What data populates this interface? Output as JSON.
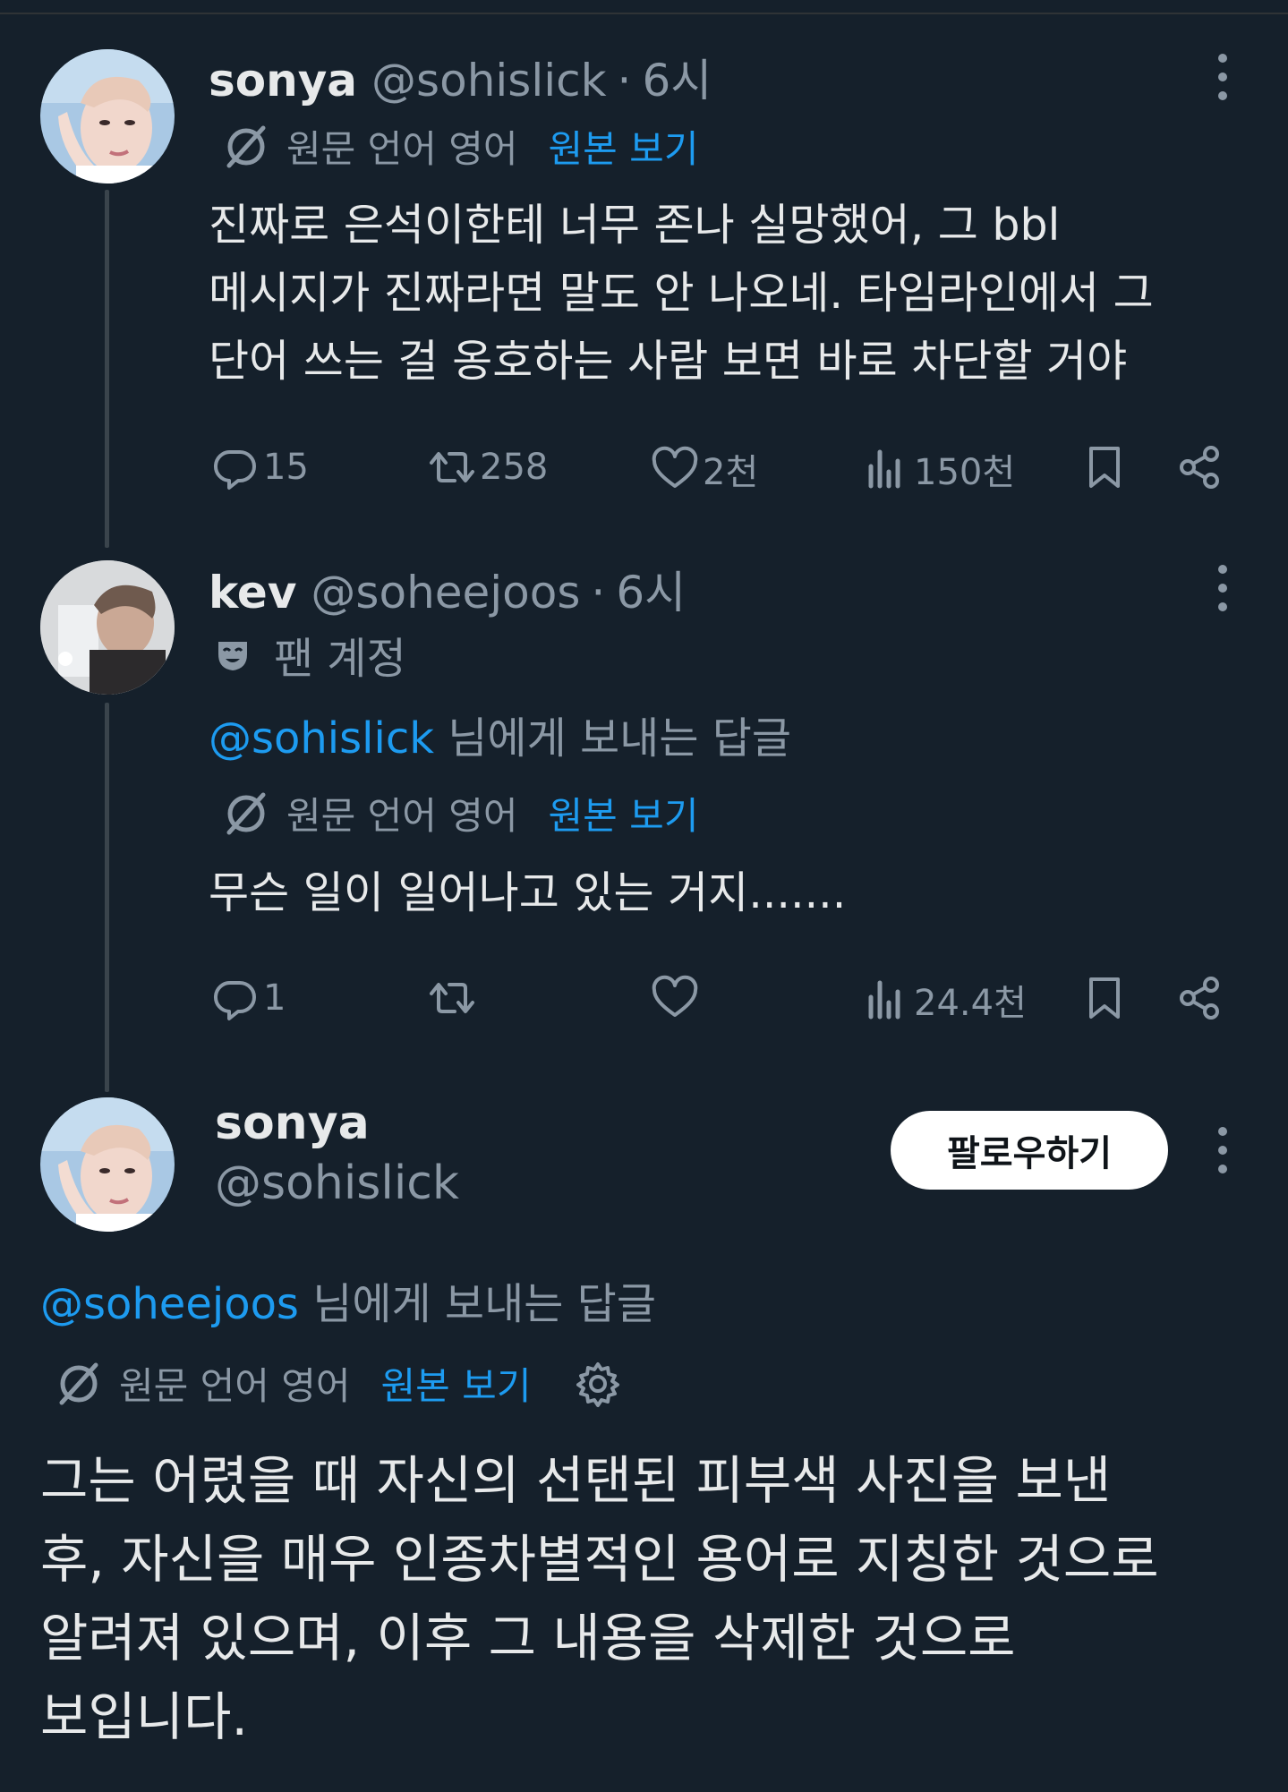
{
  "tweets": [
    {
      "name": "sonya",
      "handle": "@sohislick",
      "separator": "·",
      "time": "6시",
      "translation": {
        "label": "원문 언어 영어",
        "link": "원본 보기"
      },
      "text": "진짜로 은석이한테 너무 존나 실망했어, 그 bbl\n메시지가 진짜라면 말도 안 나오네. 타임라인에서 그\n단어 쓰는 걸 옹호하는 사람 보면 바로 차단할 거야",
      "stats": {
        "replies": "15",
        "retweets": "258",
        "likes": "2천",
        "views": "150천"
      }
    },
    {
      "name": "kev",
      "handle": "@soheejoos",
      "separator": "·",
      "time": "6시",
      "fan_label": "팬 계정",
      "reply_mention": "@sohislick",
      "reply_suffix": " 님에게 보내는 답글",
      "translation": {
        "label": "원문 언어 영어",
        "link": "원본 보기"
      },
      "text": "무슨 일이 일어나고 있는 거지.......",
      "stats": {
        "replies": "1",
        "retweets": "",
        "likes": "",
        "views": "24.4천"
      }
    },
    {
      "name": "sonya",
      "handle": "@sohislick",
      "follow_label": "팔로우하기",
      "reply_mention": "@soheejoos",
      "reply_suffix": " 님에게 보내는 답글",
      "translation": {
        "label": "원문 언어 영어",
        "link": "원본 보기"
      },
      "text": "그는 어렸을 때 자신의 선탠된 피부색 사진을 보낸\n후, 자신을 매우 인종차별적인 용어로 지칭한 것으로\n알려져 있으며, 이후 그 내용을 삭제한 것으로\n보입니다."
    }
  ],
  "colors": {
    "background": "#15202b",
    "text": "#e7e9ea",
    "muted": "#8b98a5",
    "accent": "#1d9bf0",
    "thread_line": "#3a444c"
  },
  "icons": [
    "translate-icon",
    "reply-icon",
    "retweet-icon",
    "like-icon",
    "views-icon",
    "bookmark-icon",
    "share-icon",
    "more-icon",
    "fan-mask-icon",
    "gear-icon"
  ]
}
